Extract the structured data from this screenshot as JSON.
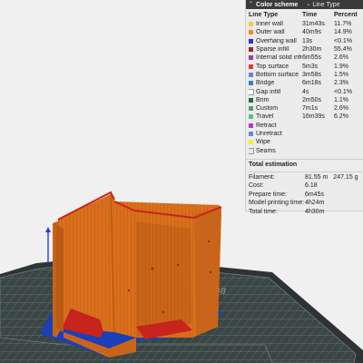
{
  "panel": {
    "title": "Color scheme",
    "selector_value": "Line Type",
    "headers": {
      "name": "Line Type",
      "time": "Time",
      "percent": "Percent"
    },
    "rows": [
      {
        "name": "Inner wall",
        "time": "31m43s",
        "percent": "11.7%",
        "color": "#f2cd42"
      },
      {
        "name": "Outer wall",
        "time": "40m9s",
        "percent": "14.9%",
        "color": "#f08b2a"
      },
      {
        "name": "Overhang wall",
        "time": "13s",
        "percent": "<0.1%",
        "color": "#2f34c9"
      },
      {
        "name": "Sparse infill",
        "time": "2h30m",
        "percent": "55.4%",
        "color": "#8f2d2d"
      },
      {
        "name": "Internal solid infill",
        "time": "6m55s",
        "percent": "2.6%",
        "color": "#a23cb4"
      },
      {
        "name": "Top surface",
        "time": "5m3s",
        "percent": "1.9%",
        "color": "#e03a3a"
      },
      {
        "name": "Bottom surface",
        "time": "3m58s",
        "percent": "1.5%",
        "color": "#6f7fe0"
      },
      {
        "name": "Bridge",
        "time": "6m18s",
        "percent": "2.3%",
        "color": "#3d7fb0"
      },
      {
        "name": "Gap infill",
        "time": "4s",
        "percent": "<0.1%",
        "color": "#ffffff"
      },
      {
        "name": "Brim",
        "time": "2m50s",
        "percent": "1.1%",
        "color": "#1f6f3a"
      },
      {
        "name": "Custom",
        "time": "7m1s",
        "percent": "2.6%",
        "color": "#4fa06b"
      },
      {
        "name": "Travel",
        "time": "16m39s",
        "percent": "6.2%",
        "color": "#4ec48a"
      },
      {
        "name": "Retract",
        "time": "",
        "percent": "",
        "color": "#b03ad0"
      },
      {
        "name": "Unretract",
        "time": "",
        "percent": "",
        "color": "#5b8fd6"
      },
      {
        "name": "Wipe",
        "time": "",
        "percent": "",
        "color": "#f3f32a"
      },
      {
        "name": "Seams",
        "time": "",
        "percent": "",
        "color": "#e6e6e6"
      }
    ]
  },
  "estimation": {
    "title": "Total estimation",
    "filament_label": "Filament:",
    "filament_length": "81.55 m",
    "filament_weight": "247.15 g",
    "cost_label": "Cost:",
    "cost_value": "6.18",
    "prepare_label": "Prepare time:",
    "prepare_value": "6m45s",
    "model_time_label": "Model printing time:",
    "model_time_value": "4h24m",
    "total_label": "Total time:",
    "total_value": "4h30m"
  },
  "viewport": {
    "plate_text": "Bambu",
    "model_color": "#d96f1c",
    "top_surface_color": "#c8231c",
    "brim_color": "#1b3fb8"
  }
}
